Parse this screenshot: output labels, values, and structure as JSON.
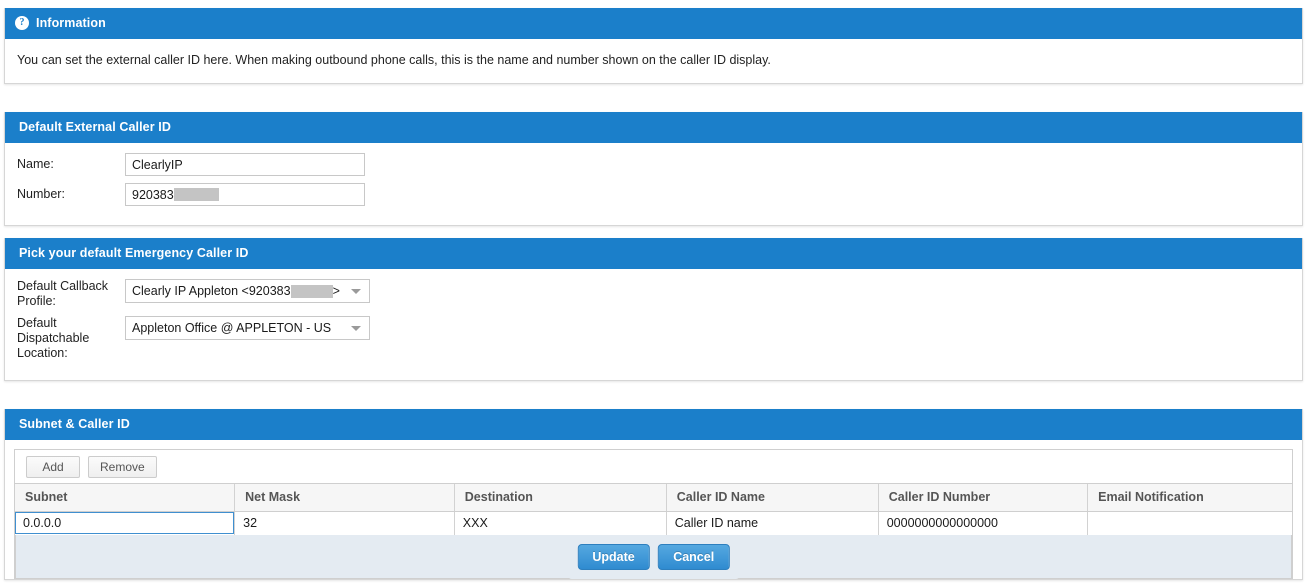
{
  "info": {
    "title": "Information",
    "icon": "question-mark-icon",
    "icon_glyph": "?",
    "text": "You can set the external caller ID here. When making outbound phone calls, this is the name and number shown on the caller ID display."
  },
  "default_caller_id": {
    "title": "Default External Caller ID",
    "name_label": "Name:",
    "name_value": "ClearlyIP",
    "number_label": "Number:",
    "number_value": "920383",
    "number_redacted": true
  },
  "emergency": {
    "title": "Pick your default Emergency Caller ID",
    "callback_label": "Default Callback Profile:",
    "callback_value_prefix": "Clearly IP Appleton <920383",
    "callback_value_suffix": ">",
    "callback_redacted": true,
    "dispatch_label": "Default Dispatchable Location:",
    "dispatch_value": "Appleton Office @ APPLETON - US"
  },
  "subnet": {
    "title": "Subnet & Caller ID",
    "add_label": "Add",
    "remove_label": "Remove",
    "columns": [
      "Subnet",
      "Net Mask",
      "Destination",
      "Caller ID Name",
      "Caller ID Number",
      "Email Notification"
    ],
    "rows": [
      {
        "subnet": "0.0.0.0",
        "net_mask": "32",
        "destination": "XXX",
        "caller_id_name": "Caller ID name",
        "caller_id_number": "0000000000000000",
        "email_notification": ""
      }
    ],
    "update_label": "Update",
    "cancel_label": "Cancel"
  },
  "colors": {
    "header_blue": "#1b7fca",
    "button_blue": "#2f8bd0",
    "focus_blue": "#3f8fd0",
    "footer_band": "#e4ebf2",
    "redaction_gray": "#c4c4c4"
  }
}
